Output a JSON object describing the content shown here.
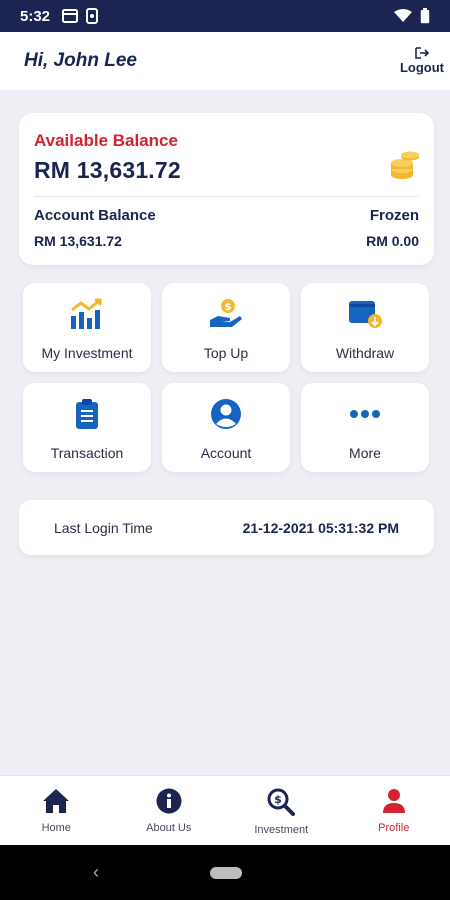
{
  "status_bar": {
    "time": "5:32"
  },
  "header": {
    "greeting": "Hi, John Lee",
    "logout_label": "Logout"
  },
  "balance": {
    "available_label": "Available Balance",
    "available_value": "RM 13,631.72",
    "account_label": "Account Balance",
    "account_value": "RM 13,631.72",
    "frozen_label": "Frozen",
    "frozen_value": "RM 0.00"
  },
  "actions": [
    {
      "label": "My Investment",
      "icon": "chart-bar-icon"
    },
    {
      "label": "Top Up",
      "icon": "hand-coin-icon"
    },
    {
      "label": "Withdraw",
      "icon": "wallet-icon"
    },
    {
      "label": "Transaction",
      "icon": "clipboard-icon"
    },
    {
      "label": "Account",
      "icon": "user-circle-icon"
    },
    {
      "label": "More",
      "icon": "more-dots-icon"
    }
  ],
  "last_login": {
    "label": "Last Login Time",
    "value": "21-12-2021 05:31:32 PM"
  },
  "bottom_nav": [
    {
      "label": "Home",
      "icon": "home-icon"
    },
    {
      "label": "About Us",
      "icon": "info-icon"
    },
    {
      "label": "Investment",
      "icon": "search-dollar-icon"
    },
    {
      "label": "Profile",
      "icon": "user-icon",
      "active": true
    }
  ],
  "colors": {
    "primary": "#1c2551",
    "accent_red": "#d4232f",
    "icon_blue": "#1565c0",
    "coin_gold": "#f3b72b"
  }
}
